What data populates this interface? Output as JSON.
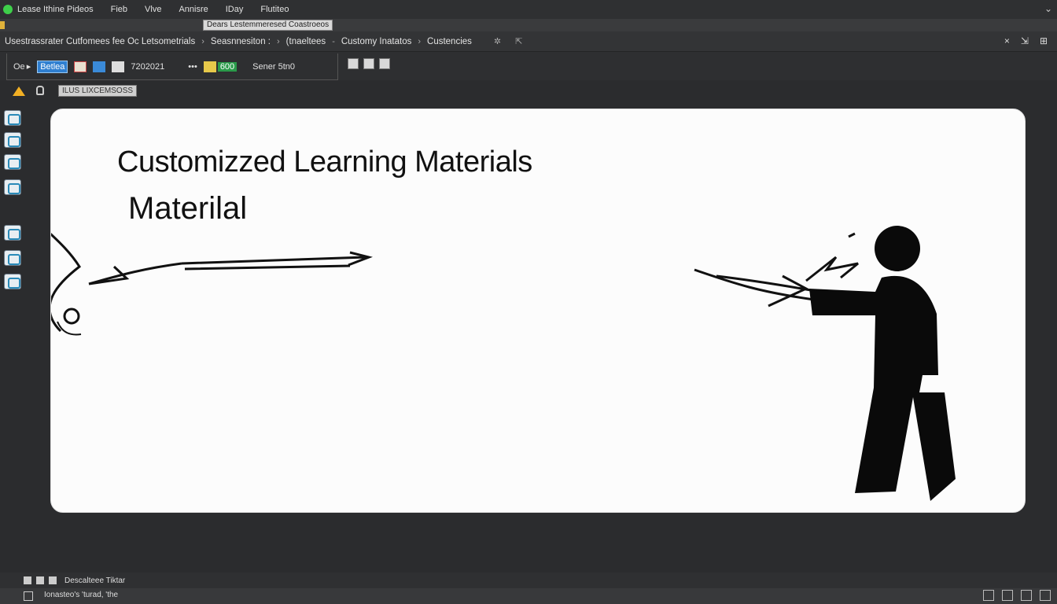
{
  "menubar": {
    "items": [
      "Lease Ithine Pideos",
      "Fieb",
      "Vlve",
      "Annisre",
      "IDay",
      "Flutiteo"
    ]
  },
  "document": {
    "title": "Dears Lestemmeresed Coastroeos"
  },
  "breadcrumbs": [
    "Usestrassrater Cutfomees fee Oc Letsometrials",
    "Seasnnesiton :",
    "(tnaeltees",
    "Customy Inatatos",
    "Custencies"
  ],
  "toolbar": {
    "item1": "Oe",
    "blue_label": "Betlea",
    "value": "7202021",
    "count": "600",
    "scene_label": "Sener 5tn0"
  },
  "mode_label": "ILUS LIXCEMSOSS",
  "canvas": {
    "title": "Customizzed Learning Materials",
    "subtitle": "Materilal"
  },
  "statusbar": {
    "label": "Descalteee Tiktar"
  },
  "bottombar": {
    "file_label": "Ionasteo's 'turad, 'the"
  },
  "colors": {
    "accent_blue": "#2f7fd0",
    "accent_green": "#2a9a4a",
    "home_icon": "#f2b024"
  }
}
